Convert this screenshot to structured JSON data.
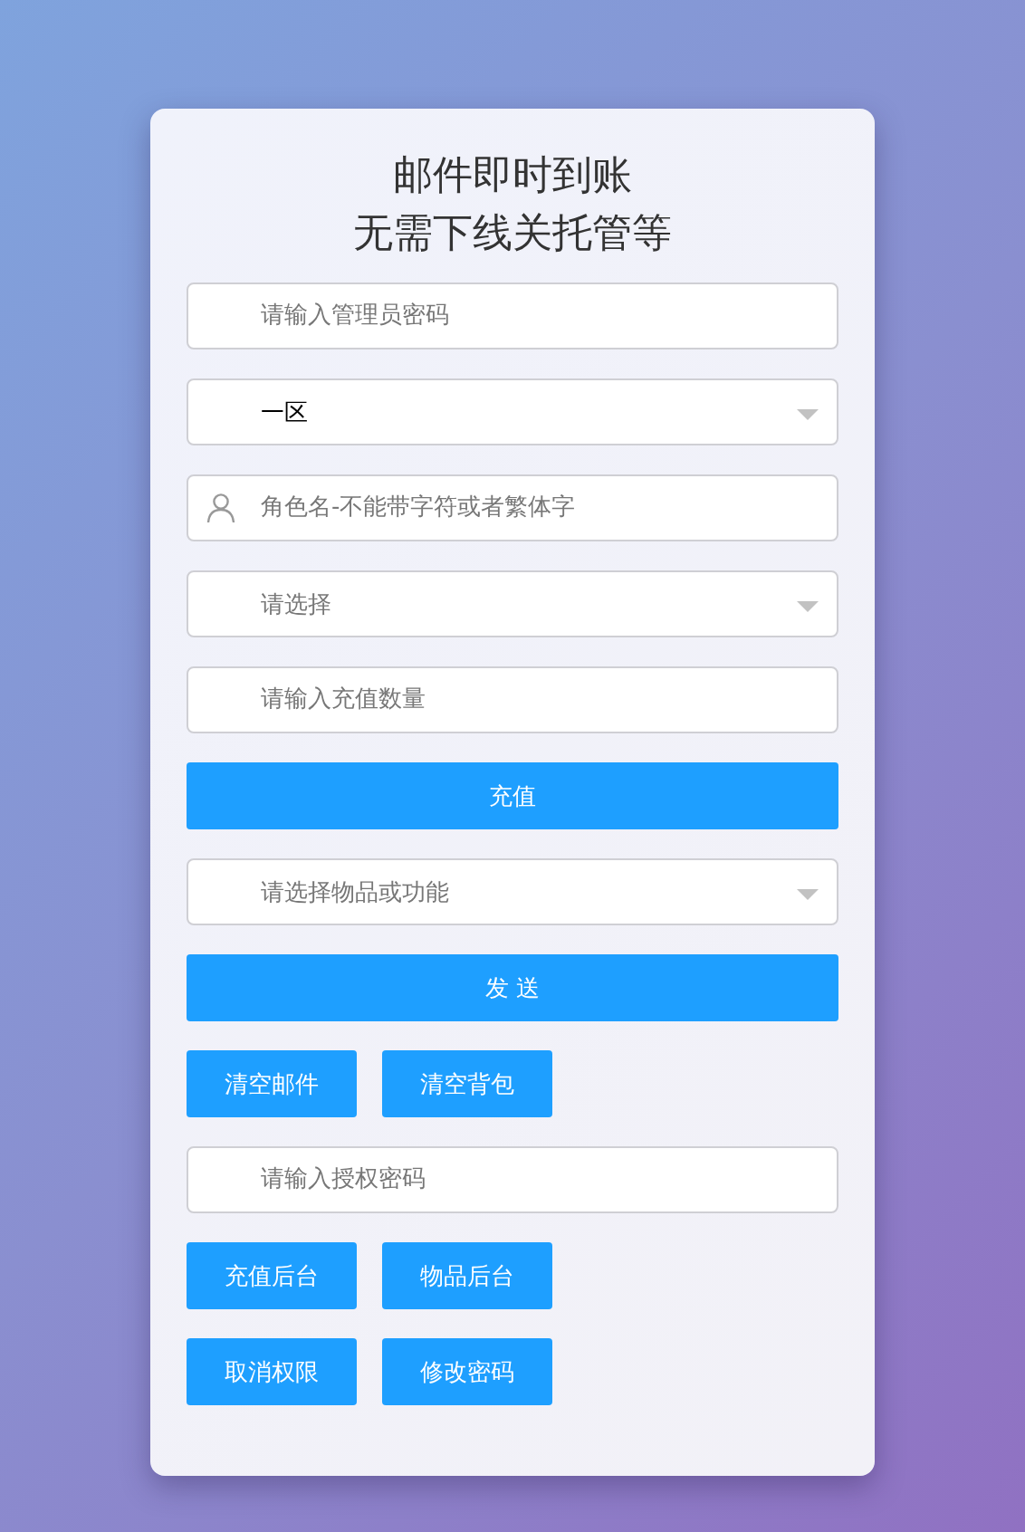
{
  "title_lines": [
    "邮件即时到账",
    "无需下线关托管等"
  ],
  "items": [
    {
      "kind": "input",
      "placeholder": "请输入管理员密码"
    },
    {
      "kind": "select",
      "value": "一区"
    },
    {
      "kind": "user-input",
      "placeholder": "角色名-不能带字符或者繁体字"
    },
    {
      "kind": "select",
      "placeholder": "请选择"
    },
    {
      "kind": "input",
      "placeholder": "请输入充值数量"
    },
    {
      "kind": "button",
      "label": "充值"
    },
    {
      "kind": "select",
      "placeholder": "请选择物品或功能"
    },
    {
      "kind": "button",
      "label": "发 送"
    },
    {
      "kind": "buttons",
      "labels": [
        "清空邮件",
        "清空背包"
      ]
    },
    {
      "kind": "input",
      "placeholder": "请输入授权密码"
    },
    {
      "kind": "buttons",
      "labels": [
        "充值后台",
        "物品后台"
      ]
    },
    {
      "kind": "buttons",
      "labels": [
        "取消权限",
        "修改密码"
      ]
    }
  ]
}
